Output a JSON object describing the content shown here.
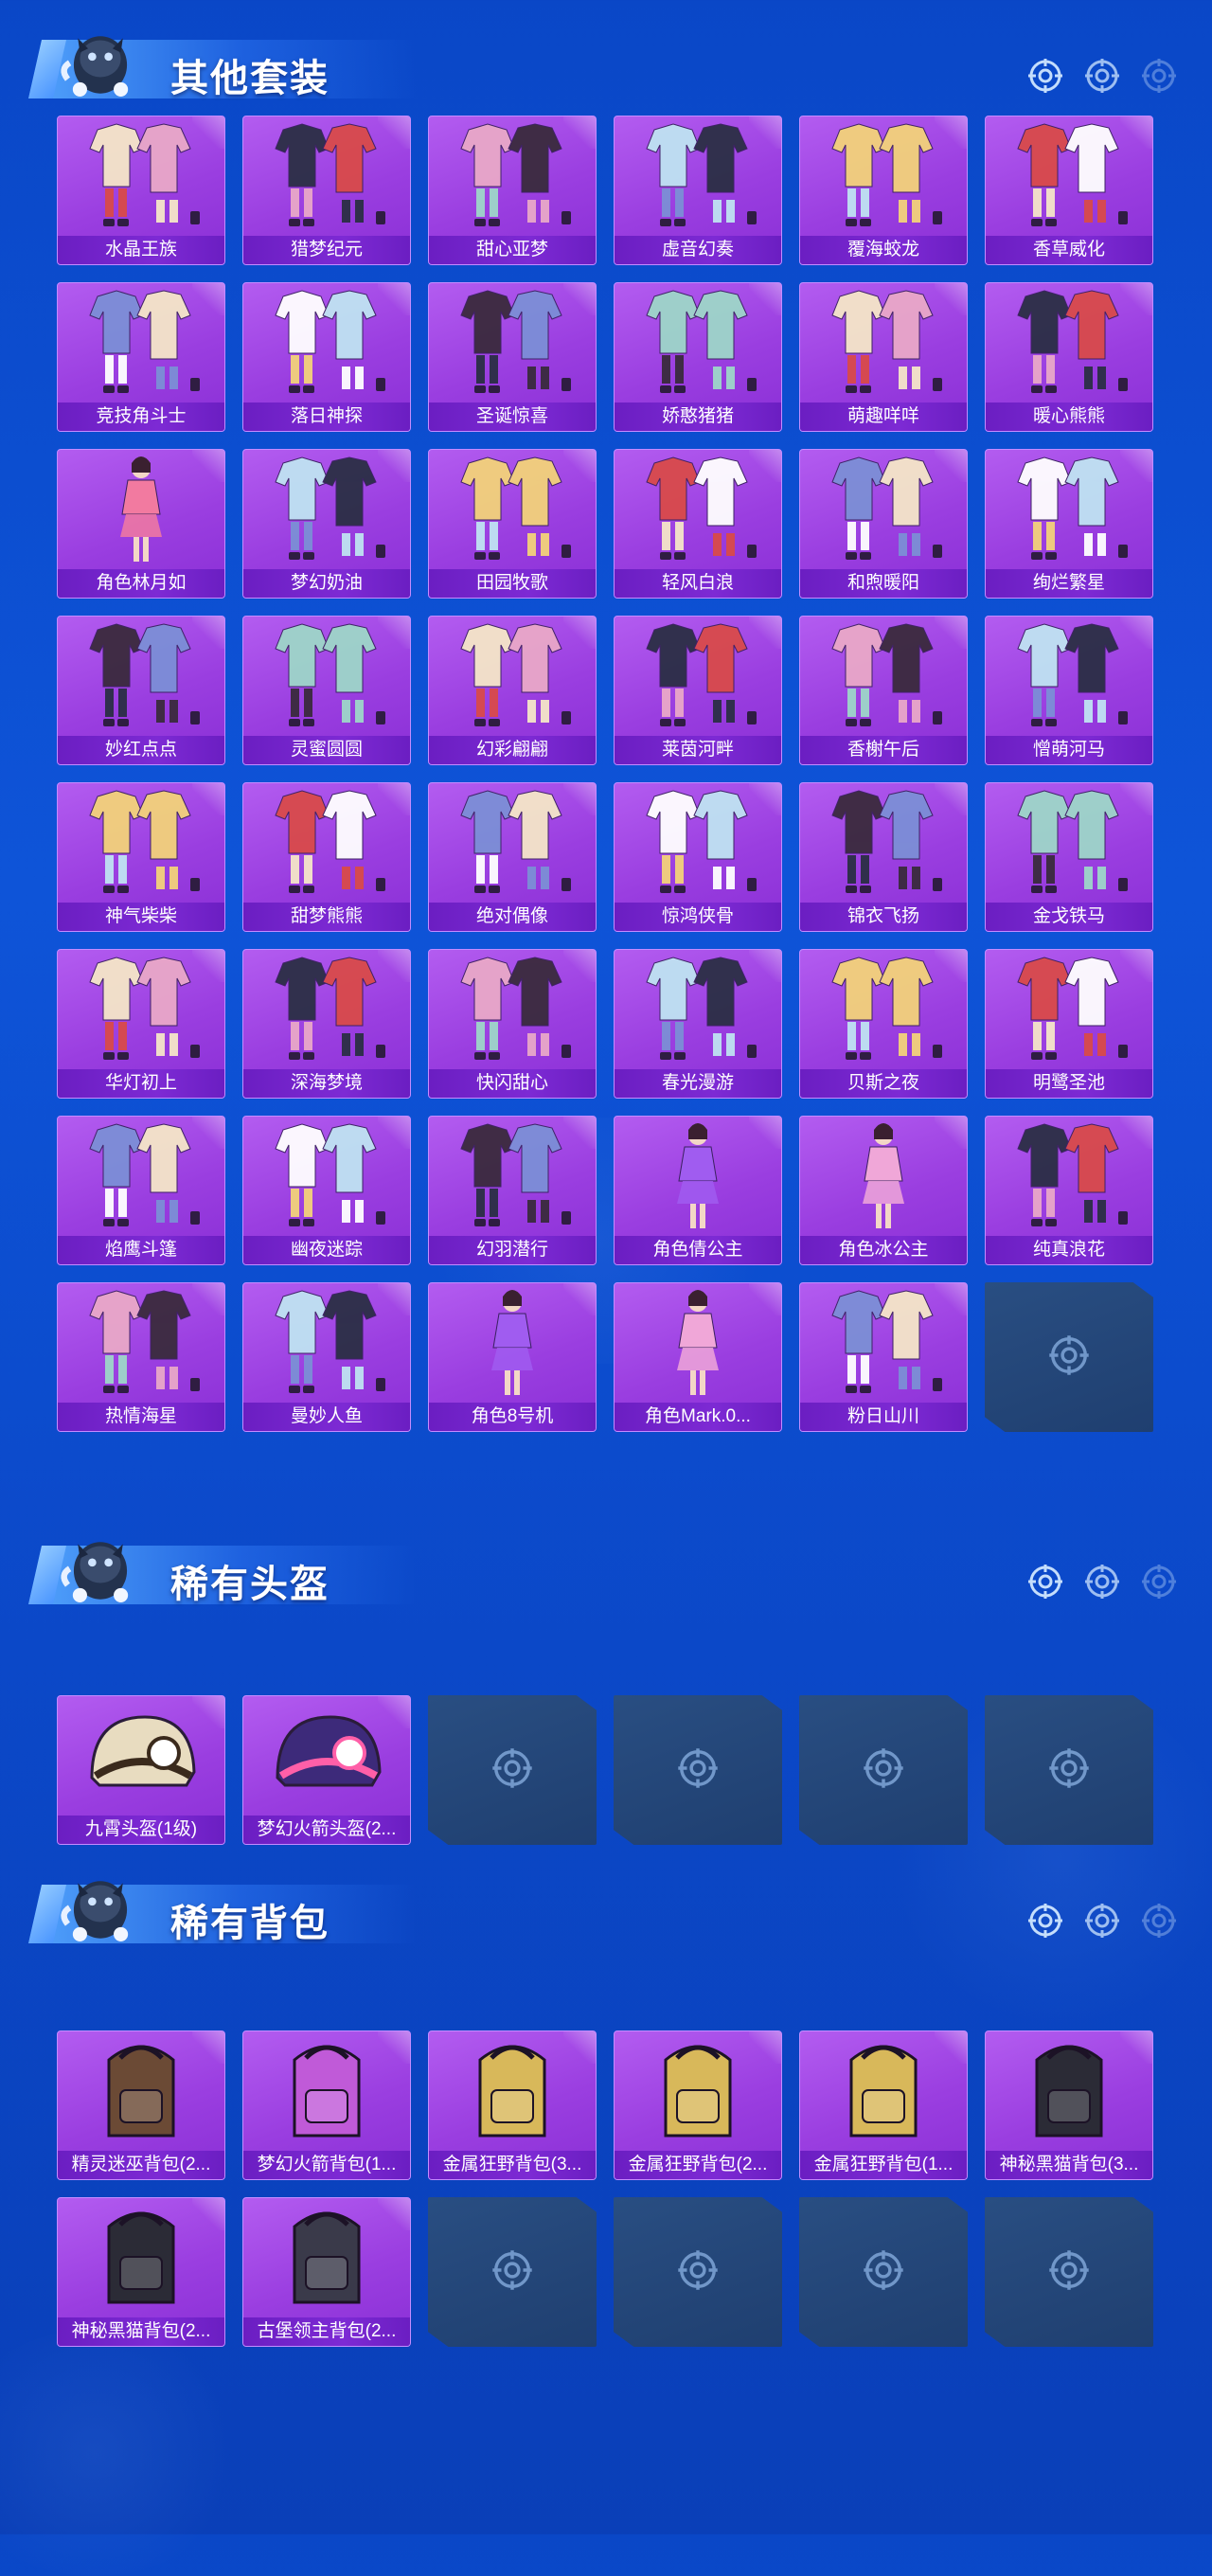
{
  "colors": {
    "background": "#0b4bcf",
    "card_purple": "#9a3ee0",
    "label_bar": "#7420c9",
    "empty_slot": "#24467a",
    "accent_light": "#8fc6ff"
  },
  "sections": [
    {
      "title": "其他套装",
      "items": [
        {
          "label": "水晶王族",
          "icon": "outfit-set-icon"
        },
        {
          "label": "猎梦纪元",
          "icon": "outfit-set-icon"
        },
        {
          "label": "甜心亚梦",
          "icon": "outfit-set-icon"
        },
        {
          "label": "虚音幻奏",
          "icon": "outfit-set-icon"
        },
        {
          "label": "覆海蛟龙",
          "icon": "outfit-set-icon"
        },
        {
          "label": "香草威化",
          "icon": "outfit-set-icon"
        },
        {
          "label": "竞技角斗士",
          "icon": "outfit-set-icon"
        },
        {
          "label": "落日神探",
          "icon": "outfit-set-icon"
        },
        {
          "label": "圣诞惊喜",
          "icon": "outfit-set-icon"
        },
        {
          "label": "娇憨猪猪",
          "icon": "outfit-set-icon"
        },
        {
          "label": "萌趣咩咩",
          "icon": "outfit-set-icon"
        },
        {
          "label": "暖心熊熊",
          "icon": "outfit-set-icon"
        },
        {
          "label": "角色林月如",
          "icon": "character-icon"
        },
        {
          "label": "梦幻奶油",
          "icon": "outfit-set-icon"
        },
        {
          "label": "田园牧歌",
          "icon": "outfit-set-icon"
        },
        {
          "label": "轻风白浪",
          "icon": "outfit-set-icon"
        },
        {
          "label": "和煦暖阳",
          "icon": "outfit-set-icon"
        },
        {
          "label": "绚烂繁星",
          "icon": "outfit-set-icon"
        },
        {
          "label": "妙红点点",
          "icon": "outfit-set-icon"
        },
        {
          "label": "灵蜜圆圆",
          "icon": "outfit-set-icon"
        },
        {
          "label": "幻彩翩翩",
          "icon": "outfit-set-icon"
        },
        {
          "label": "莱茵河畔",
          "icon": "outfit-set-icon"
        },
        {
          "label": "香榭午后",
          "icon": "outfit-set-icon"
        },
        {
          "label": "憎萌河马",
          "icon": "outfit-set-icon"
        },
        {
          "label": "神气柴柴",
          "icon": "outfit-set-icon"
        },
        {
          "label": "甜梦熊熊",
          "icon": "outfit-set-icon"
        },
        {
          "label": "绝对偶像",
          "icon": "outfit-set-icon"
        },
        {
          "label": "惊鸿侠骨",
          "icon": "outfit-set-icon"
        },
        {
          "label": "锦衣飞扬",
          "icon": "outfit-set-icon"
        },
        {
          "label": "金戈铁马",
          "icon": "outfit-set-icon"
        },
        {
          "label": "华灯初上",
          "icon": "outfit-set-icon"
        },
        {
          "label": "深海梦境",
          "icon": "outfit-set-icon"
        },
        {
          "label": "快闪甜心",
          "icon": "outfit-set-icon"
        },
        {
          "label": "春光漫游",
          "icon": "outfit-set-icon"
        },
        {
          "label": "贝斯之夜",
          "icon": "outfit-set-icon"
        },
        {
          "label": "明鹭圣池",
          "icon": "outfit-set-icon"
        },
        {
          "label": "焰鹰斗篷",
          "icon": "outfit-set-icon"
        },
        {
          "label": "幽夜迷踪",
          "icon": "outfit-set-icon"
        },
        {
          "label": "幻羽潜行",
          "icon": "outfit-set-icon"
        },
        {
          "label": "角色倩公主",
          "icon": "character-icon"
        },
        {
          "label": "角色冰公主",
          "icon": "character-icon"
        },
        {
          "label": "纯真浪花",
          "icon": "outfit-set-icon"
        },
        {
          "label": "热情海星",
          "icon": "outfit-set-icon"
        },
        {
          "label": "曼妙人鱼",
          "icon": "outfit-set-icon"
        },
        {
          "label": "角色8号机",
          "icon": "character-icon"
        },
        {
          "label": "角色Mark.0...",
          "icon": "character-icon"
        },
        {
          "label": "粉日山川",
          "icon": "outfit-set-icon"
        }
      ],
      "empty_slots": 1
    },
    {
      "title": "稀有头盔",
      "items": [
        {
          "label": "九霄头盔(1级)",
          "icon": "helmet-icon"
        },
        {
          "label": "梦幻火箭头盔(2...",
          "icon": "helmet-icon"
        }
      ],
      "empty_slots": 4
    },
    {
      "title": "稀有背包",
      "items": [
        {
          "label": "精灵迷巫背包(2...",
          "icon": "backpack-icon"
        },
        {
          "label": "梦幻火箭背包(1...",
          "icon": "backpack-icon"
        },
        {
          "label": "金属狂野背包(3...",
          "icon": "backpack-icon"
        },
        {
          "label": "金属狂野背包(2...",
          "icon": "backpack-icon"
        },
        {
          "label": "金属狂野背包(1...",
          "icon": "backpack-icon"
        },
        {
          "label": "神秘黑猫背包(3...",
          "icon": "backpack-icon"
        },
        {
          "label": "神秘黑猫背包(2...",
          "icon": "backpack-icon"
        },
        {
          "label": "古堡领主背包(2...",
          "icon": "backpack-icon"
        }
      ],
      "empty_slots": 4
    }
  ]
}
